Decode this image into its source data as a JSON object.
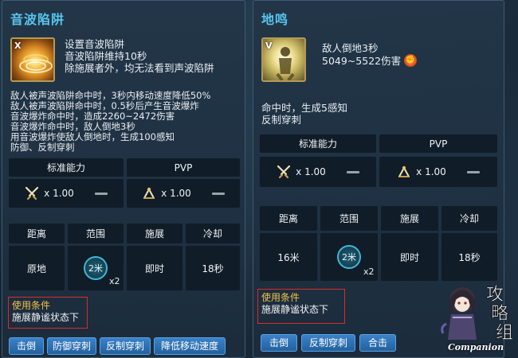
{
  "left_panel": {
    "title": "音波陷阱",
    "icon_key": "X",
    "header_lines": [
      "设置音波陷阱",
      "音波陷阱维持10秒",
      "除施展者外，均无法看到声波陷阱"
    ],
    "description_lines": [
      "敌人被声波陷阱命中时，3秒内移动速度降低50%",
      "敌人被声波陷阱命中时，0.5秒后产生音波爆炸",
      "音波爆炸命中时，造成2260~2472伤害",
      "音波爆炸命中时，敌人倒地3秒",
      "用音波爆炸使敌人倒地时，生成100感知",
      "防御、反制穿刺"
    ],
    "ability_header": "标准能力",
    "pvp_header": "PVP",
    "standard_multiplier": "x 1.00",
    "pvp_multiplier": "x 1.00",
    "stats": {
      "distance_label": "距离",
      "range_label": "范围",
      "cast_label": "施展",
      "cooldown_label": "冷却",
      "distance_value": "原地",
      "range_value": "2米",
      "range_multiplier": "x2",
      "cast_value": "即时",
      "cooldown_value": "18秒"
    },
    "condition_title": "使用条件",
    "condition_text": "施展静谧状态下",
    "tags": [
      "击倒",
      "防御穿刺",
      "反制穿刺",
      "降低移动速度"
    ]
  },
  "right_panel": {
    "title": "地鸣",
    "icon_key": "V",
    "header_lines": [
      "敌人倒地3秒"
    ],
    "damage_text": "5049~5522伤害",
    "description_lines": [
      "命中时，生成5感知",
      "反制穿刺"
    ],
    "ability_header": "标准能力",
    "pvp_header": "PVP",
    "standard_multiplier": "x 1.00",
    "pvp_multiplier": "x 1.00",
    "stats": {
      "distance_label": "距离",
      "range_label": "范围",
      "cast_label": "施展",
      "cooldown_label": "冷却",
      "distance_value": "16米",
      "range_value": "2米",
      "range_multiplier": "x2",
      "cast_value": "即时",
      "cooldown_value": "18秒"
    },
    "condition_title": "使用条件",
    "condition_text": "施展静谧状态下",
    "tags": [
      "击倒",
      "反制穿刺",
      "合击"
    ]
  },
  "watermark": {
    "text": "Companion"
  },
  "colors": {
    "title": "#58c6ee",
    "condition_title": "#f2c24b",
    "highlight_box": "#d62d2d",
    "tag_bg": "#2f74bb"
  }
}
